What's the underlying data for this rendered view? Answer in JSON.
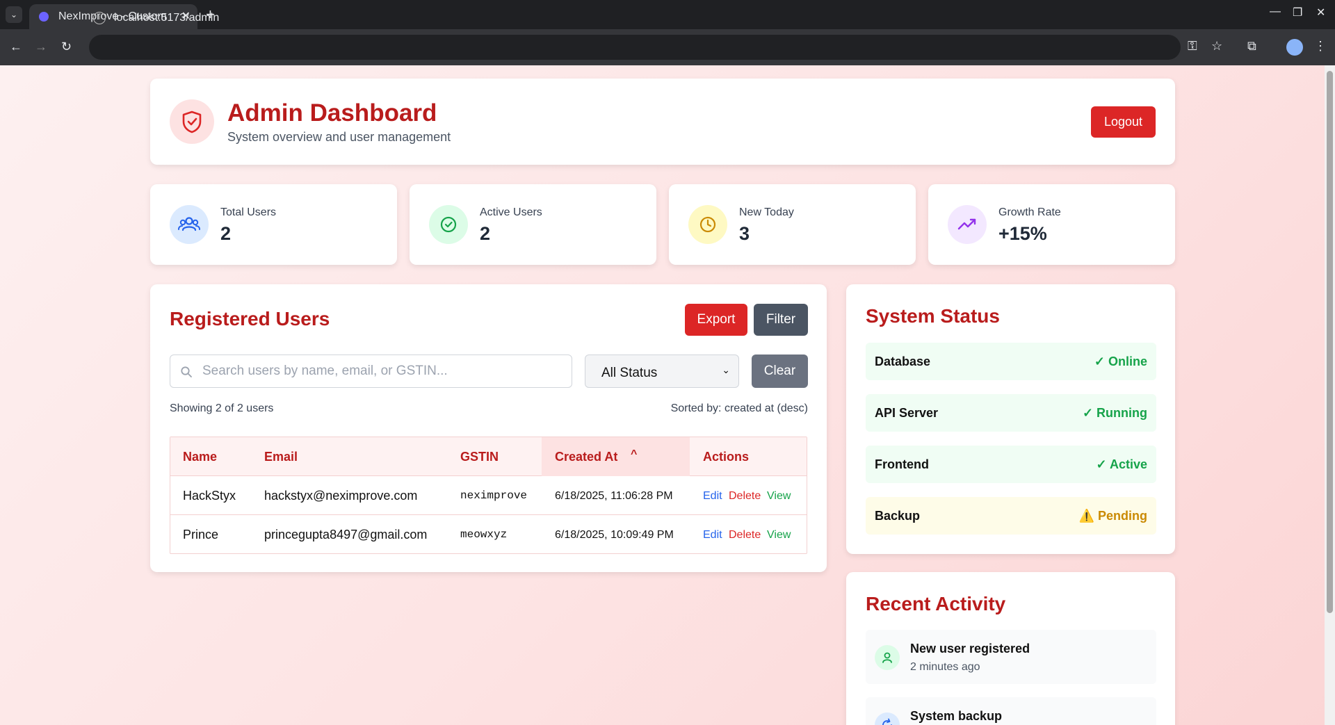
{
  "browser": {
    "tab_title": "NexImprove - Custom",
    "url": "localhost:5173/admin"
  },
  "header": {
    "title": "Admin Dashboard",
    "subtitle": "System overview and user management",
    "logout_label": "Logout"
  },
  "stats": [
    {
      "label": "Total Users",
      "value": "2",
      "icon": "users-icon",
      "color": "#2563eb"
    },
    {
      "label": "Active Users",
      "value": "2",
      "icon": "check-circle-icon",
      "color": "#16a34a"
    },
    {
      "label": "New Today",
      "value": "3",
      "icon": "clock-icon",
      "color": "#ca8a04"
    },
    {
      "label": "Growth Rate",
      "value": "+15%",
      "icon": "trending-up-icon",
      "color": "#9333ea"
    }
  ],
  "users": {
    "title": "Registered Users",
    "export_label": "Export",
    "filter_label": "Filter",
    "search_placeholder": "Search users by name, email, or GSTIN...",
    "status_select": "All Status",
    "clear_label": "Clear",
    "showing_text": "Showing 2 of 2 users",
    "sorted_text": "Sorted by: created at (desc)",
    "columns": [
      "Name",
      "Email",
      "GSTIN",
      "Created At",
      "Actions"
    ],
    "rows": [
      {
        "name": "HackStyx",
        "email": "hackstyx@neximprove.com",
        "gstin": "neximprove",
        "created": "6/18/2025, 11:06:28 PM"
      },
      {
        "name": "Prince",
        "email": "princegupta8497@gmail.com",
        "gstin": "meowxyz",
        "created": "6/18/2025, 10:09:49 PM"
      }
    ],
    "actions": {
      "edit": "Edit",
      "delete": "Delete",
      "view": "View"
    }
  },
  "system_status": {
    "title": "System Status",
    "items": [
      {
        "label": "Database",
        "value": "✓ Online"
      },
      {
        "label": "API Server",
        "value": "✓ Running"
      },
      {
        "label": "Frontend",
        "value": "✓ Active"
      },
      {
        "label": "Backup",
        "value": "⚠️ Pending"
      }
    ]
  },
  "recent_activity": {
    "title": "Recent Activity",
    "items": [
      {
        "title": "New user registered",
        "time": "2 minutes ago"
      },
      {
        "title": "System backup",
        "time": ""
      }
    ]
  },
  "colors": {
    "brand_red": "#b91c1c",
    "button_red": "#dc2626",
    "button_gray": "#4b5563",
    "success_green": "#16a34a",
    "warning_amber": "#ca8a04"
  }
}
